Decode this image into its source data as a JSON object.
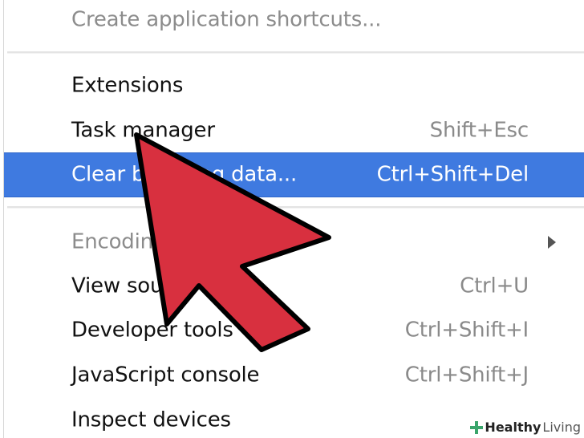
{
  "menu": {
    "items": [
      {
        "label": "Create application shortcuts...",
        "shortcut": "",
        "state": "disabled",
        "submenu": false
      },
      {
        "label": "Extensions",
        "shortcut": "",
        "state": "normal",
        "submenu": false
      },
      {
        "label": "Task manager",
        "shortcut": "Shift+Esc",
        "state": "normal",
        "submenu": false
      },
      {
        "label": "Clear browsing data...",
        "shortcut": "Ctrl+Shift+Del",
        "state": "highlighted",
        "submenu": false
      },
      {
        "label": "Encoding",
        "shortcut": "",
        "state": "disabled",
        "submenu": true
      },
      {
        "label": "View source",
        "shortcut": "Ctrl+U",
        "state": "normal",
        "submenu": false
      },
      {
        "label": "Developer tools",
        "shortcut": "Ctrl+Shift+I",
        "state": "normal",
        "submenu": false
      },
      {
        "label": "JavaScript console",
        "shortcut": "Ctrl+Shift+J",
        "state": "normal",
        "submenu": false
      },
      {
        "label": "Inspect devices",
        "shortcut": "",
        "state": "normal",
        "submenu": false
      }
    ]
  },
  "overlay": {
    "cursor_icon": "arrow-cursor-icon",
    "cursor_color": "#d8303f"
  },
  "watermark": {
    "icon": "plus-cross-icon",
    "brand_bold": "Healthy",
    "brand_light": "Living"
  },
  "colors": {
    "highlight": "#3f7ae0",
    "disabled_text": "#8c8c8c",
    "shortcut_text": "#8a8a8a"
  }
}
